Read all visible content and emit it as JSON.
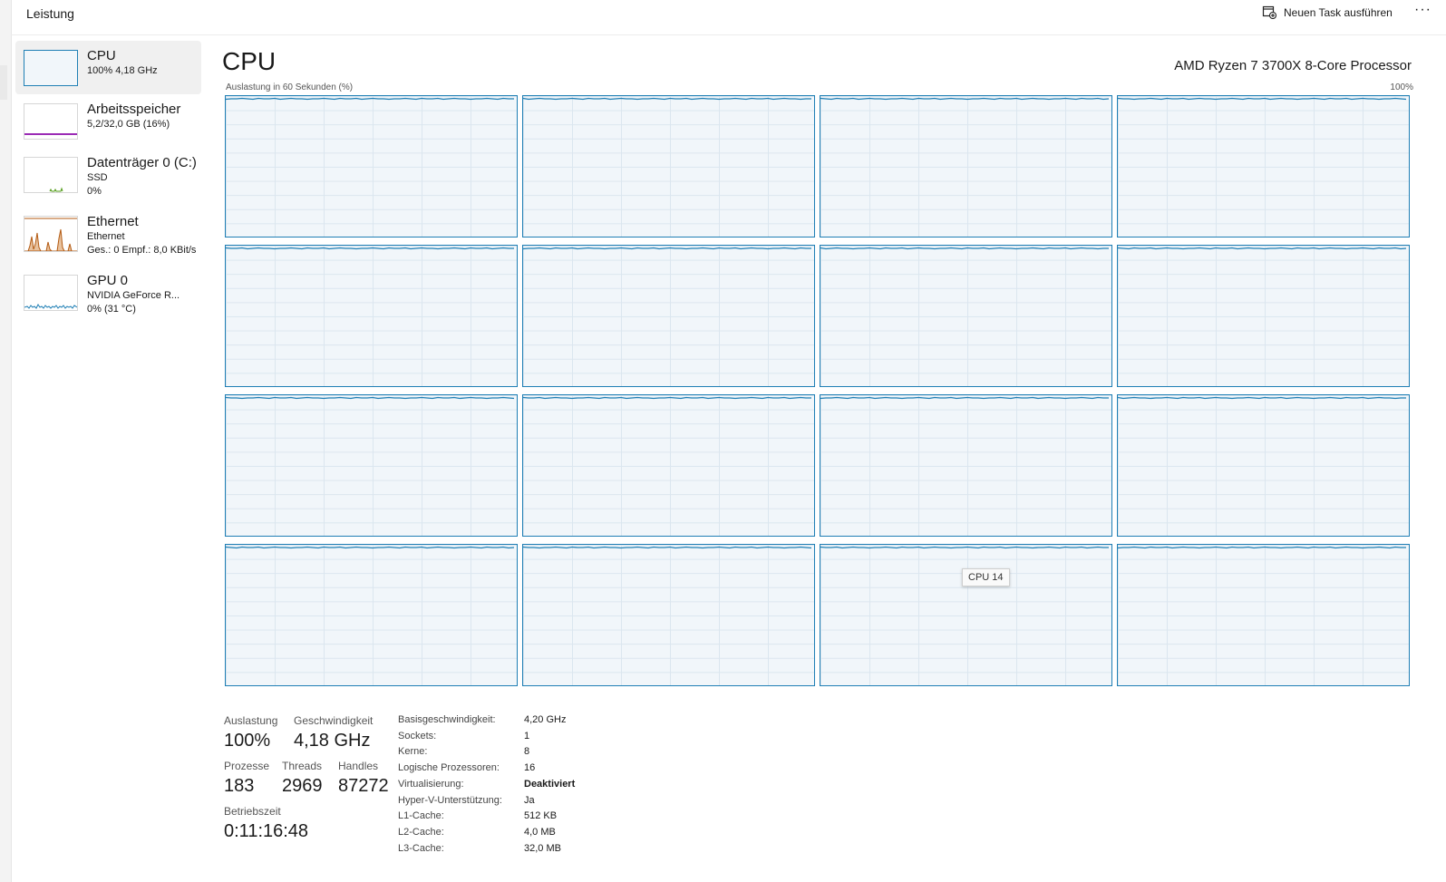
{
  "header": {
    "title": "Leistung",
    "run_task_label": "Neuen Task ausführen",
    "more_label": "···"
  },
  "sidebar": {
    "items": [
      {
        "name": "CPU",
        "sub1": "100% 4,18 GHz",
        "sub2": "",
        "graph_color": "#1f7fb5"
      },
      {
        "name": "Arbeitsspeicher",
        "sub1": "5,2/32,0 GB (16%)",
        "sub2": "",
        "graph_color": "#9b2bb5"
      },
      {
        "name": "Datenträger 0 (C:)",
        "sub1": "SSD",
        "sub2": "0%",
        "graph_color": "#4f9a14"
      },
      {
        "name": "Ethernet",
        "sub1": "Ethernet",
        "sub2": "Ges.: 0 Empf.: 8,0 KBit/s",
        "graph_color": "#b35a12"
      },
      {
        "name": "GPU 0",
        "sub1": "NVIDIA GeForce R...",
        "sub2": "0% (31 °C)",
        "graph_color": "#1f7fb5"
      }
    ]
  },
  "main": {
    "title": "CPU",
    "processor": "AMD Ryzen 7 3700X 8-Core Processor",
    "graph_label": "Auslastung in 60 Sekunden (%)",
    "graph_max": "100%",
    "logical_cpu_count": 16,
    "line_color": "#1f7fb5",
    "tooltip": "CPU 14"
  },
  "stats": {
    "auslastung_label": "Auslastung",
    "auslastung_value": "100%",
    "geschwindigkeit_label": "Geschwindigkeit",
    "geschwindigkeit_value": "4,18 GHz",
    "prozesse_label": "Prozesse",
    "prozesse_value": "183",
    "threads_label": "Threads",
    "threads_value": "2969",
    "handles_label": "Handles",
    "handles_value": "87272",
    "betriebszeit_label": "Betriebszeit",
    "betriebszeit_value": "0:11:16:48"
  },
  "specs": [
    {
      "key": "Basisgeschwindigkeit:",
      "value": "4,20 GHz",
      "bold": false
    },
    {
      "key": "Sockets:",
      "value": "1",
      "bold": false
    },
    {
      "key": "Kerne:",
      "value": "8",
      "bold": false
    },
    {
      "key": "Logische Prozessoren:",
      "value": "16",
      "bold": false
    },
    {
      "key": "Virtualisierung:",
      "value": "Deaktiviert",
      "bold": true
    },
    {
      "key": "Hyper-V-Unterstützung:",
      "value": "Ja",
      "bold": false
    },
    {
      "key": "L1-Cache:",
      "value": "512 KB",
      "bold": false
    },
    {
      "key": "L2-Cache:",
      "value": "4,0 MB",
      "bold": false
    },
    {
      "key": "L3-Cache:",
      "value": "32,0 MB",
      "bold": false
    }
  ]
}
